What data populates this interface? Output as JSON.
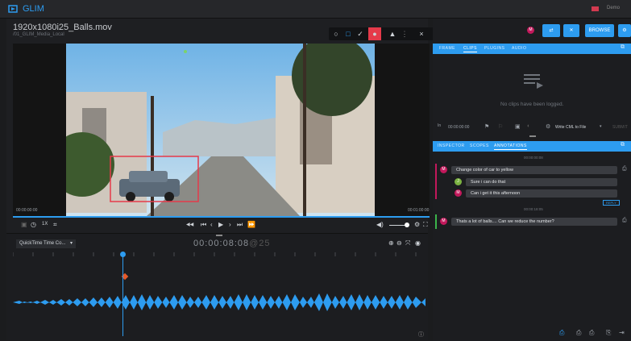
{
  "app": {
    "name": "GLIM",
    "user_label": "Demo"
  },
  "file": {
    "title": "1920x1080i25_Balls.mov",
    "path": "/01_GLIM_Media_Local"
  },
  "toolbar": {
    "tools": [
      "circle-tool",
      "rectangle-tool",
      "pen-tool",
      "color-swatch",
      "pointer-tool",
      "more-tool",
      "close-tool"
    ],
    "close_label": "×"
  },
  "video": {
    "start_tc": "00:00:00:00",
    "end_tc": "00:01:00:00"
  },
  "controls": {
    "speed": "1X",
    "frame_back": "◀◀",
    "play": "▶"
  },
  "timeline": {
    "selector": "QuickTime Time Co...",
    "timecode_main": "00:00:08:08",
    "timecode_frames": "@25"
  },
  "right": {
    "top_buttons": {
      "browse": "BROWSE",
      "avatar_letter": "M"
    },
    "clips_tabs": [
      "FRAME",
      "CLIPS",
      "PLUGINS",
      "AUDIO"
    ],
    "clips_empty": "No clips have been logged.",
    "clips_footer": {
      "in_label": "In",
      "in_tc": "00:00:00:00",
      "write_label": "Write CML to File",
      "submit": "SUBMIT"
    },
    "panel_tabs": [
      "INSPECTOR",
      "SCOPES",
      "ANNOTATIONS"
    ],
    "annotations": [
      {
        "time": "00:00:00:08",
        "text": "Change color of car to yellow",
        "avatar": "M",
        "color": "#c2185b"
      },
      {
        "text": "Sure i can do that",
        "avatar": "J",
        "color": "#7cb342"
      },
      {
        "text": "Can i get it this afternoon",
        "avatar": "M",
        "color": "#c2185b"
      },
      {
        "time": "00:00:18:05",
        "text": "Thats a lot of balls.... Can we reduce the number?",
        "avatar": "M",
        "color": "#c2185b"
      }
    ],
    "reply_label": "REPLY"
  },
  "colors": {
    "accent": "#2d9cf0",
    "danger": "#e53a4a"
  }
}
